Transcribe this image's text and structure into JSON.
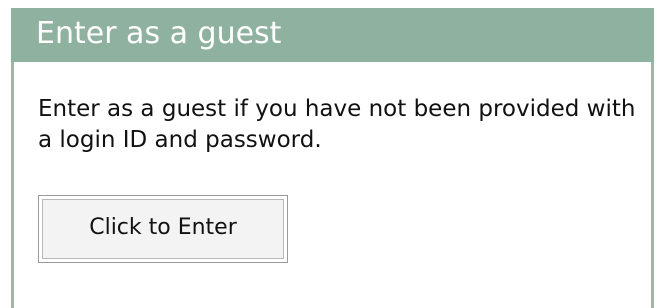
{
  "panel": {
    "title": "Enter as a guest",
    "description": "Enter as a guest if you have not been provided with a login ID and password.",
    "button_label": "Click to Enter"
  },
  "colors": {
    "header_background": "#8fb19f",
    "border": "#96bba6",
    "header_text": "#ffffff"
  }
}
